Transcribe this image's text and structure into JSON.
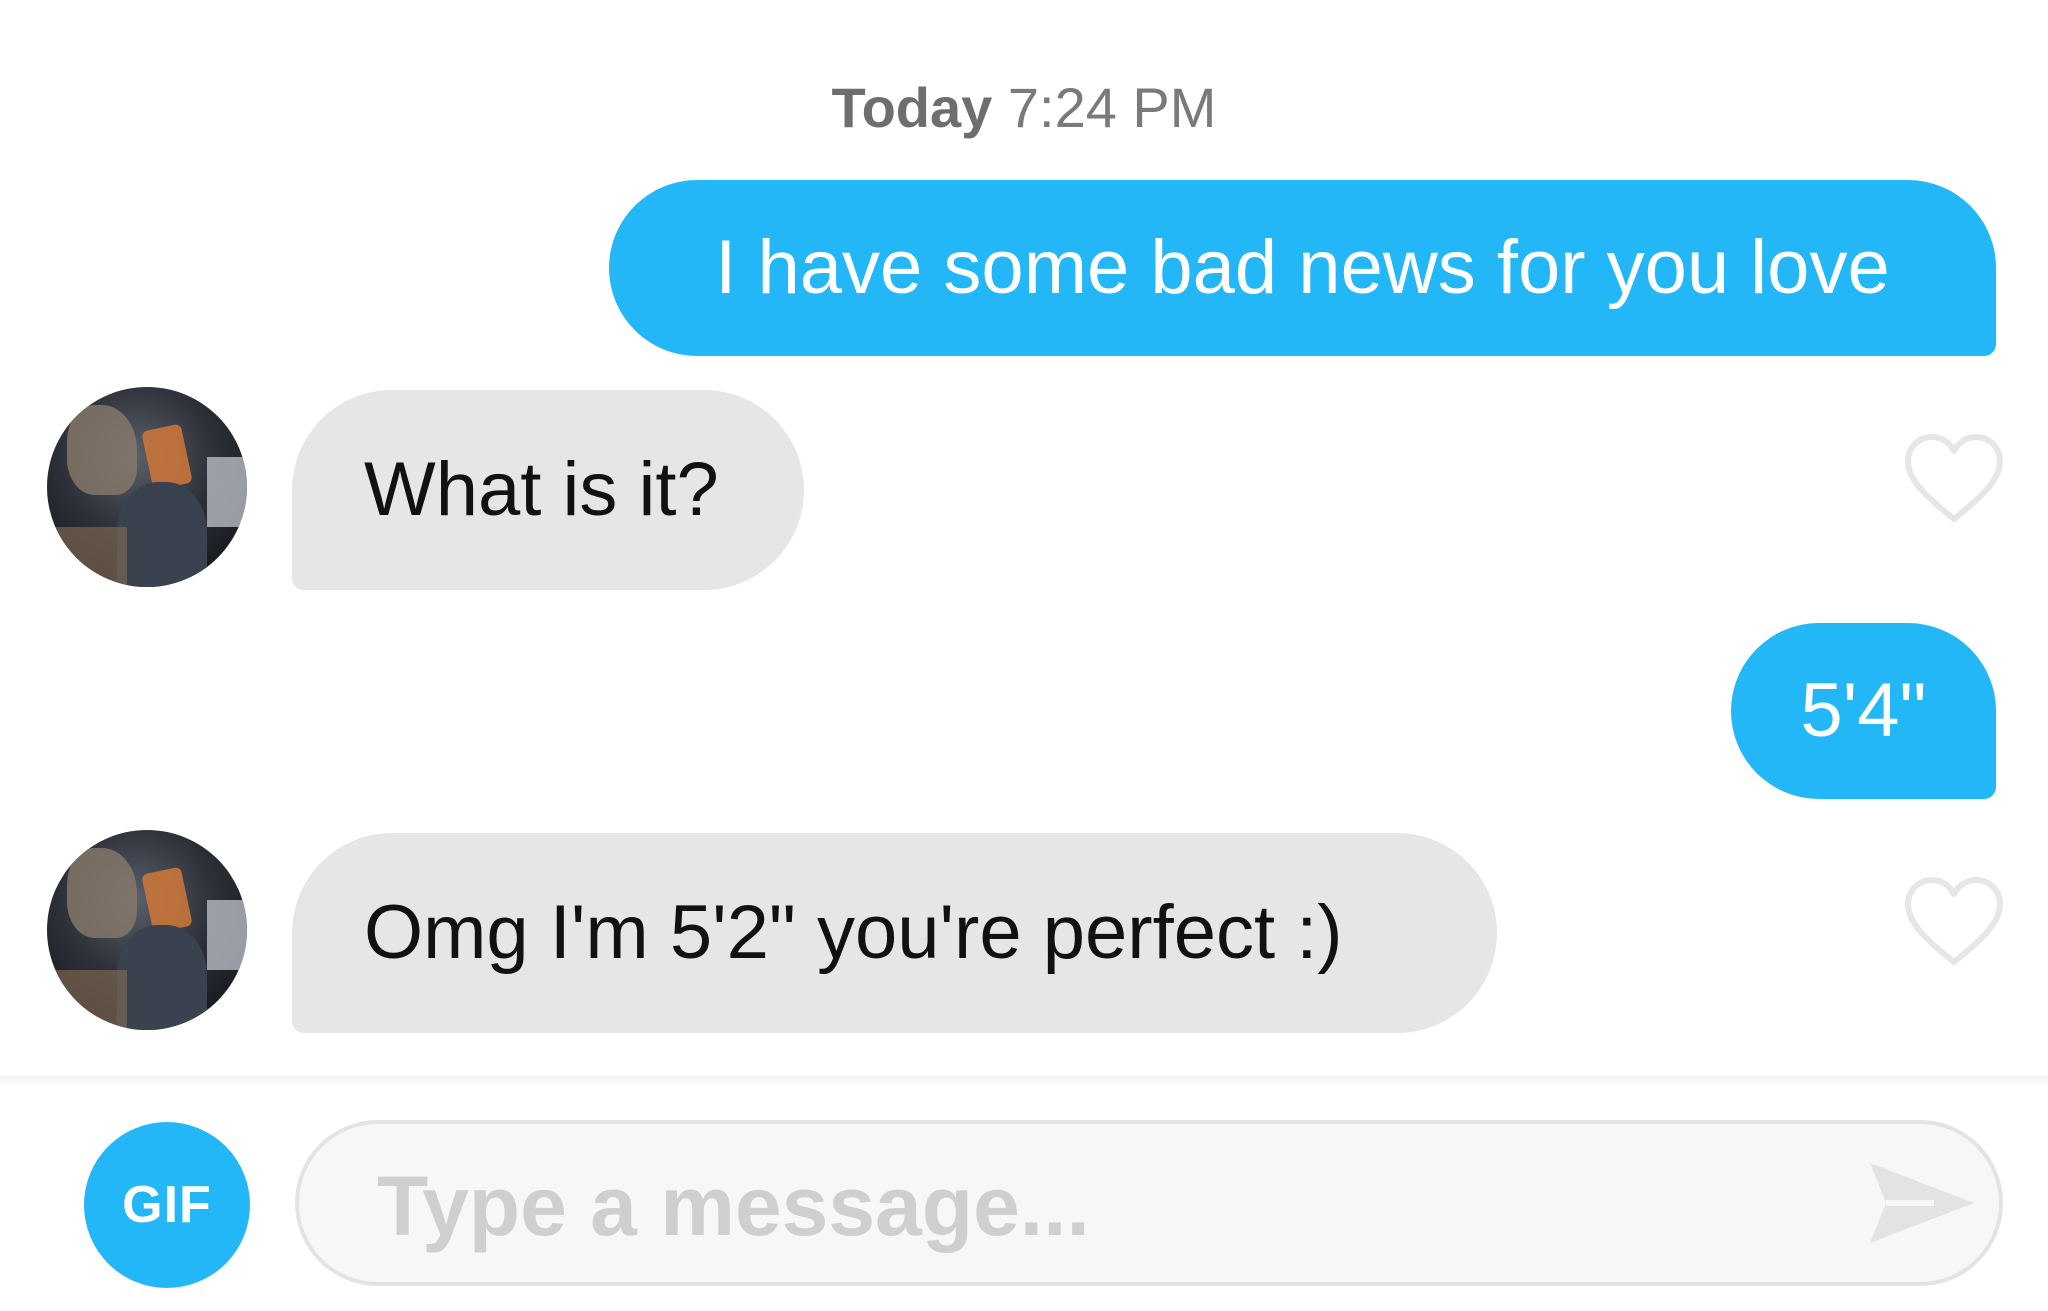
{
  "conversation": {
    "timestamp_day": "Today",
    "timestamp_time": "7:24 PM",
    "messages": [
      {
        "direction": "outgoing",
        "text": "I have some bad news for you love"
      },
      {
        "direction": "incoming",
        "text": "What is it?"
      },
      {
        "direction": "outgoing",
        "text": "5'4\""
      },
      {
        "direction": "incoming",
        "text": "Omg I'm 5'2\" you're perfect :)"
      }
    ]
  },
  "composer": {
    "gif_label": "GIF",
    "placeholder": "Type a message...",
    "value": ""
  },
  "icons": {
    "heart": "heart-outline-icon",
    "send": "send-icon"
  },
  "colors": {
    "accent": "#23b7f7",
    "incoming_bubble": "#e6e6e6",
    "placeholder": "#cfcfcf",
    "heart_outline": "#e6e6e6"
  }
}
